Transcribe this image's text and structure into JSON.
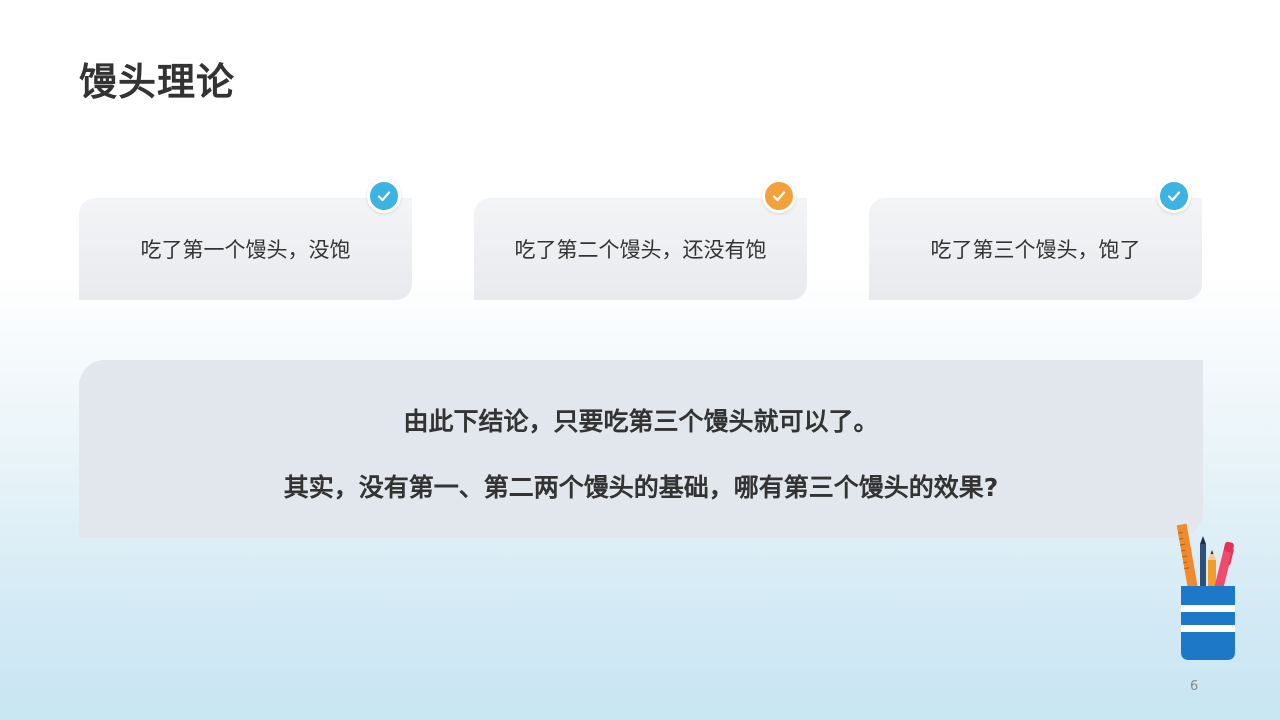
{
  "title": "馒头理论",
  "cards": [
    {
      "text": "吃了第一个馒头，没饱",
      "badge_color": "#3cb3e0",
      "badge_icon": "check-icon"
    },
    {
      "text": "吃了第二个馒头，还没有饱",
      "badge_color": "#f3a13d",
      "badge_icon": "check-icon"
    },
    {
      "text": "吃了第三个馒头，饱了",
      "badge_color": "#3cb3e0",
      "badge_icon": "check-icon"
    }
  ],
  "conclusion": {
    "line1": "由此下结论，只要吃第三个馒头就可以了。",
    "line2": "其实，没有第一、第二两个馒头的基础，哪有第三个馒头的效果?"
  },
  "page_number": "6",
  "colors": {
    "title": "#333333",
    "card_bg": "#eceef1",
    "conclusion_bg": "#e1e7ec",
    "badge_blue": "#3cb3e0",
    "badge_orange": "#f3a13d",
    "pen_holder_blue": "#1e78c8"
  }
}
